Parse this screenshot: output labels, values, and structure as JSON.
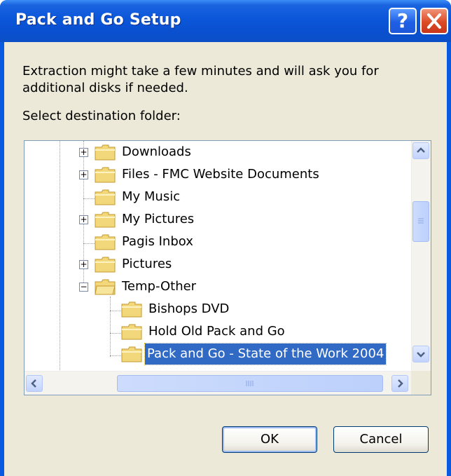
{
  "window": {
    "title": "Pack and Go Setup"
  },
  "titlebar_buttons": {
    "help_label": "?"
  },
  "dialog": {
    "message": "Extraction might take a few minutes and will ask you for additional disks if needed.",
    "select_label": "Select destination folder:"
  },
  "tree": {
    "nodes": [
      {
        "label": "Downloads",
        "expander": "+"
      },
      {
        "label": "Files - FMC Website Documents",
        "expander": "+"
      },
      {
        "label": "My Music",
        "expander": ""
      },
      {
        "label": "My Pictures",
        "expander": "+"
      },
      {
        "label": "Pagis Inbox",
        "expander": ""
      },
      {
        "label": "Pictures",
        "expander": "+"
      },
      {
        "label": "Temp-Other",
        "expander": "−"
      },
      {
        "label": "Bishops DVD",
        "expander": ""
      },
      {
        "label": "Hold Old Pack and Go",
        "expander": ""
      },
      {
        "label": "Pack and Go - State of the Work 2004",
        "expander": "",
        "selected": true
      }
    ]
  },
  "buttons": {
    "ok": "OK",
    "cancel": "Cancel"
  },
  "colors": {
    "titlebar": "#0a50cf",
    "selection": "#316ac5",
    "dialog_bg": "#ece9d8"
  }
}
